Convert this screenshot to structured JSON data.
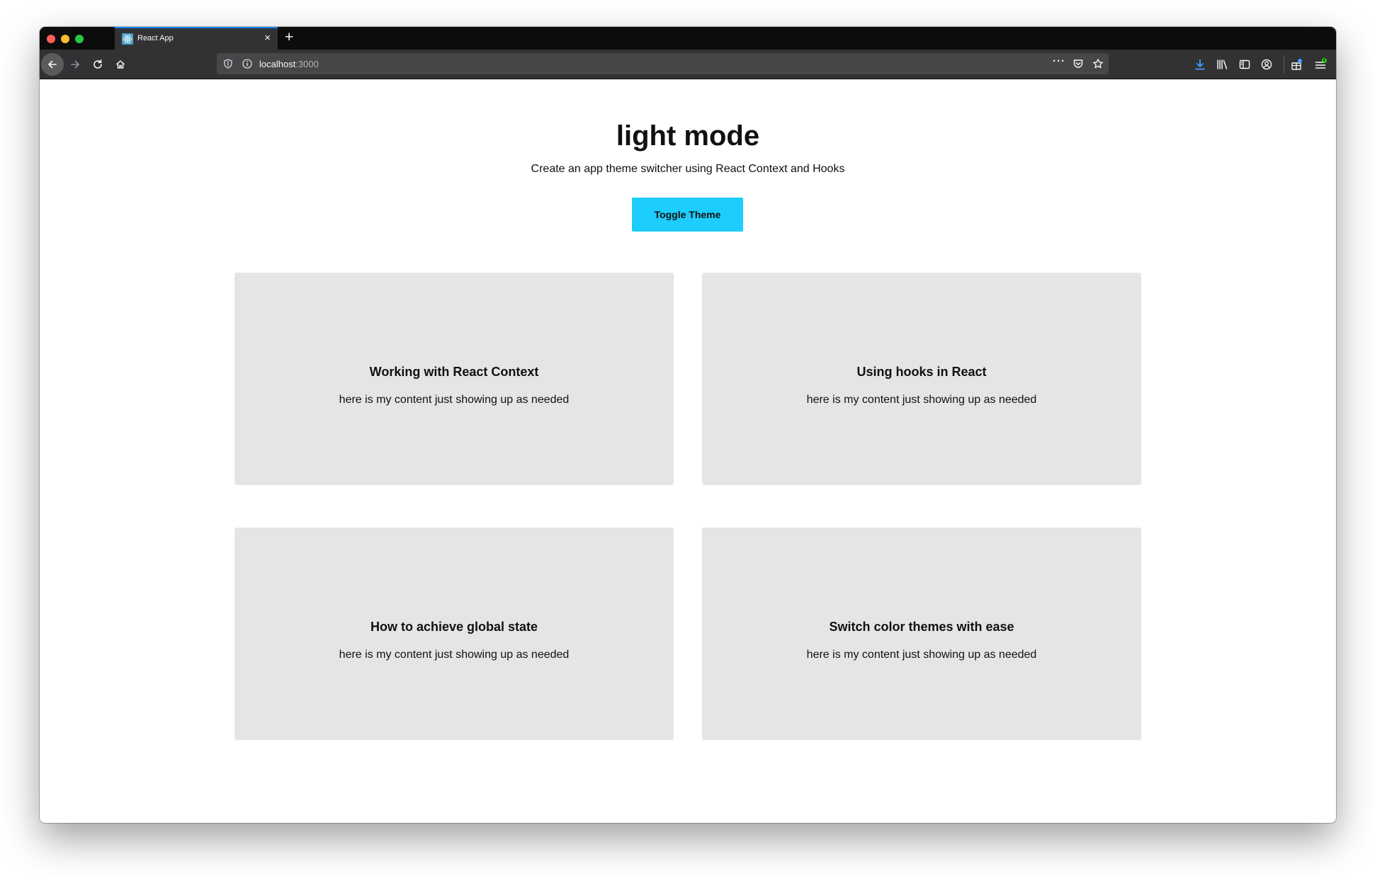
{
  "browser": {
    "tab": {
      "title": "React App",
      "close_glyph": "×"
    },
    "new_tab_glyph": "+",
    "url": {
      "host": "localhost",
      "port": ":3000"
    },
    "more_glyph": "···",
    "icons": [
      "back-icon",
      "forward-icon",
      "reload-icon",
      "home-icon",
      "shield-icon",
      "info-icon",
      "page-actions-icon",
      "pocket-icon",
      "bookmark-star-icon",
      "download-icon",
      "library-icon",
      "sidebar-icon",
      "account-icon",
      "extensions-icon",
      "menu-icon"
    ],
    "colors": {
      "tabbar": "#0c0c0d",
      "toolbar": "#323234",
      "urlbar": "#474749",
      "tab_accent": "#0a84ff",
      "download_accent": "#45a1ff"
    }
  },
  "page": {
    "title": "light mode",
    "subtitle": "Create an app theme switcher using React Context and Hooks",
    "toggle_button": "Toggle Theme",
    "colors": {
      "button": "#1ccdfd",
      "card": "#e5e5e5",
      "background": "#ffffff"
    },
    "cards": [
      {
        "title": "Working with React Context",
        "body": "here is my content just showing up as needed"
      },
      {
        "title": "Using hooks in React",
        "body": "here is my content just showing up as needed"
      },
      {
        "title": "How to achieve global state",
        "body": "here is my content just showing up as needed"
      },
      {
        "title": "Switch color themes with ease",
        "body": "here is my content just showing up as needed"
      }
    ]
  }
}
